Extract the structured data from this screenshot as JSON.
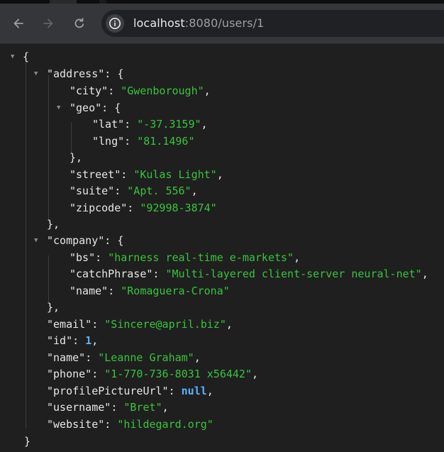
{
  "browser": {
    "url_host": "localhost",
    "url_rest": ":8080/users/1",
    "icons": {
      "back": "arrow-left-icon",
      "forward": "arrow-right-icon",
      "reload": "reload-icon",
      "site_info": "info-icon"
    }
  },
  "json": {
    "open_root": "{",
    "close_root": "}",
    "address": {
      "key": "\"address\"",
      "city_key": "\"city\"",
      "city": "\"Gwenborough\"",
      "geo_key": "\"geo\"",
      "lat_key": "\"lat\"",
      "lat": "\"-37.3159\"",
      "lng_key": "\"lng\"",
      "lng": "\"81.1496\"",
      "street_key": "\"street\"",
      "street": "\"Kulas Light\"",
      "suite_key": "\"suite\"",
      "suite": "\"Apt. 556\"",
      "zipcode_key": "\"zipcode\"",
      "zipcode": "\"92998-3874\""
    },
    "company": {
      "key": "\"company\"",
      "bs_key": "\"bs\"",
      "bs": "\"harness real-time e-markets\"",
      "catchPhrase_key": "\"catchPhrase\"",
      "catchPhrase": "\"Multi-layered client-server neural-net\"",
      "name_key": "\"name\"",
      "name": "\"Romaguera-Crona\""
    },
    "email_key": "\"email\"",
    "email": "\"Sincere@april.biz\"",
    "id_key": "\"id\"",
    "id": "1",
    "name_key": "\"name\"",
    "name": "\"Leanne Graham\"",
    "phone_key": "\"phone\"",
    "phone": "\"1-770-736-8031 x56442\"",
    "profilePictureUrl_key": "\"profilePictureUrl\"",
    "profilePictureUrl": "null",
    "username_key": "\"username\"",
    "username": "\"Bret\"",
    "website_key": "\"website\"",
    "website": "\"hildegard.org\""
  },
  "colors": {
    "toolbar": "#35363a",
    "omnibox": "#202124",
    "page_bg": "#1f1f1f",
    "string": "#38c43c",
    "keyword": "#5cb0ff",
    "key": "#e6e6e6"
  }
}
